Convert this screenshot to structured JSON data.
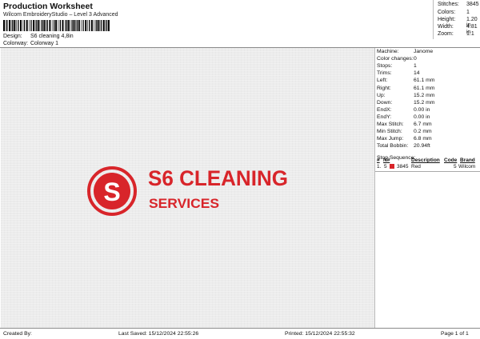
{
  "header": {
    "title": "Production Worksheet",
    "subtitle": "Wilcom EmbroideryStudio – Level 3 Advanced",
    "design_label": "Design:",
    "design_value": "S6 cleaning 4,8in",
    "colorway_label": "Colorway:",
    "colorway_value": "Colorway 1"
  },
  "stats": [
    {
      "label": "Stitches:",
      "value": "3845"
    },
    {
      "label": "Colors:",
      "value": "1"
    },
    {
      "label": "Height:",
      "value": "1.20 in"
    },
    {
      "label": "Width:",
      "value": "4.81 in"
    },
    {
      "label": "Zoom:",
      "value": "1:1"
    }
  ],
  "logo": {
    "letter": "S",
    "line1": "S6 CLEANING",
    "line2": "SERVICES",
    "color": "#d8252a"
  },
  "properties": [
    {
      "label": "Machine:",
      "value": "Janome"
    },
    {
      "label": "Color changes:",
      "value": "0"
    },
    {
      "label": "Stops:",
      "value": "1"
    },
    {
      "label": "Trims:",
      "value": "14"
    },
    {
      "label": "Left:",
      "value": "61.1 mm"
    },
    {
      "label": "Right:",
      "value": "61.1 mm"
    },
    {
      "label": "Up:",
      "value": "15.2 mm"
    },
    {
      "label": "Down:",
      "value": "15.2 mm"
    },
    {
      "label": "EndX:",
      "value": "0.00 in"
    },
    {
      "label": "EndY:",
      "value": "0.00 in"
    },
    {
      "label": "Max Stitch:",
      "value": "6.7 mm"
    },
    {
      "label": "Min Stitch:",
      "value": "0.2 mm"
    },
    {
      "label": "Max Jump:",
      "value": "6.8 mm"
    },
    {
      "label": "Total Bobbin:",
      "value": "20.94ft"
    }
  ],
  "stop_sequence": {
    "title": "Stop Sequence:",
    "columns": [
      "#",
      "N#",
      "Description",
      "Code",
      "Brand"
    ],
    "rows": [
      {
        "num": "1.",
        "n": "5",
        "stitches": "3845",
        "description": "Red",
        "code": "5",
        "brand": "Wilcom",
        "color": "#d8252a"
      }
    ]
  },
  "footer": {
    "created": "Created By:",
    "saved": "Last Saved: 15/12/2024 22:55:26",
    "printed": "Printed: 15/12/2024 22:55:32",
    "page": "Page 1 of 1"
  }
}
